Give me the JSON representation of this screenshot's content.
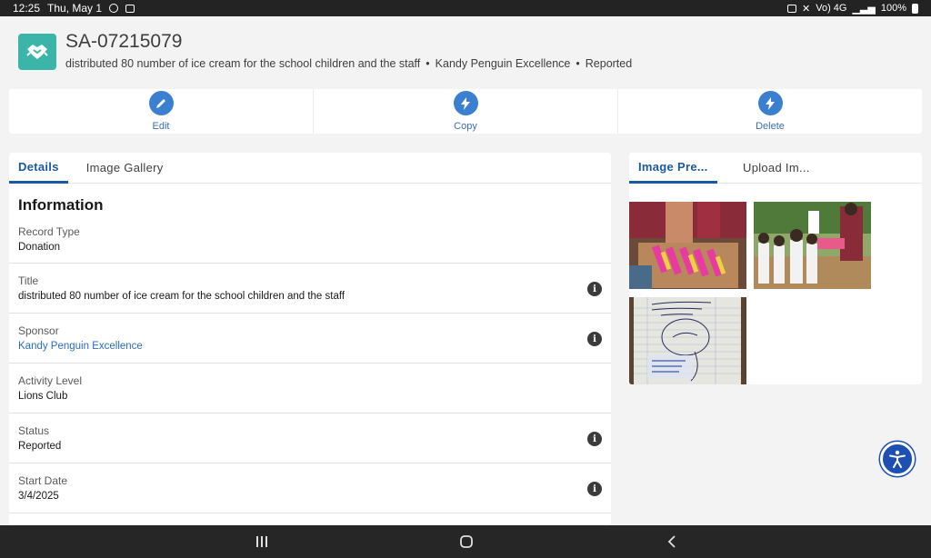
{
  "status_bar": {
    "time": "12:25",
    "date": "Thu, May 1",
    "icons_left": [
      "whatsapp-icon",
      "gallery-icon"
    ],
    "icons_right": [
      "alarm-icon",
      "mute-icon",
      "wifi-icon",
      "lte-icon",
      "signal-icon",
      "battery-icon"
    ],
    "net_label": "Vo) 4G",
    "battery": "100%"
  },
  "record": {
    "icon": "handshake-icon",
    "icon_color": "#3bb5a7",
    "title": "SA-07215079",
    "subtitle_parts": [
      "distributed 80 number of ice cream for the school children and the staff",
      "Kandy Penguin Excellence",
      "Reported"
    ]
  },
  "actions": [
    {
      "label": "Edit",
      "icon": "pencil-icon"
    },
    {
      "label": "Copy",
      "icon": "lightning-icon"
    },
    {
      "label": "Delete",
      "icon": "lightning-icon"
    }
  ],
  "left_tabs": [
    {
      "label": "Details",
      "active": true
    },
    {
      "label": "Image Gallery",
      "active": false
    }
  ],
  "section_title": "Information",
  "fields": [
    {
      "label": "Record Type",
      "value": "Donation",
      "info": false,
      "link": false
    },
    {
      "label": "Title",
      "value": "distributed 80 number of ice cream for the school children and the staff",
      "info": true,
      "link": false
    },
    {
      "label": "Sponsor",
      "value": "Kandy Penguin Excellence",
      "info": true,
      "link": true
    },
    {
      "label": "Activity Level",
      "value": "Lions Club",
      "info": false,
      "link": false
    },
    {
      "label": "Status",
      "value": "Reported",
      "info": true,
      "link": false
    },
    {
      "label": "Start Date",
      "value": "3/4/2025",
      "info": true,
      "link": false
    }
  ],
  "right_tabs": [
    {
      "label": "Image Pre...",
      "active": true
    },
    {
      "label": "Upload Im...",
      "active": false
    }
  ],
  "images": [
    {
      "name": "ice-cream-boxes-photo"
    },
    {
      "name": "children-receiving-ice-cream-photo"
    },
    {
      "name": "receipt-photo"
    }
  ],
  "colors": {
    "accent": "#1b5aa1",
    "action_blue": "#3a7fd0",
    "a11y_blue": "#1e4fb3"
  }
}
